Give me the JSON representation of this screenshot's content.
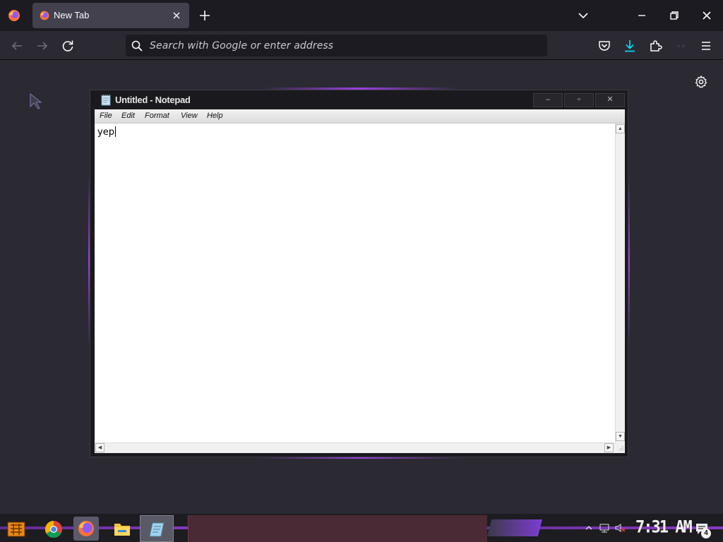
{
  "browser": {
    "tab": {
      "title": "New Tab"
    },
    "urlbar": {
      "placeholder": "Search with Google or enter address"
    }
  },
  "notepad": {
    "title": "Untitled - Notepad",
    "controls": {
      "minimize": "–",
      "maximize": "▫",
      "close": "✕"
    },
    "menu": [
      "File",
      "Edit",
      "Format",
      "View",
      "Help"
    ],
    "content": "yep"
  },
  "taskbar": {
    "apps": [
      "start-icon",
      "chrome-icon",
      "firefox-icon",
      "file-explorer-icon",
      "notepad-icon"
    ],
    "clock": "7:31 AM",
    "notification_count": "4"
  },
  "colors": {
    "accent": "#9b41e0",
    "browser_bg": "#2b2a33",
    "tabstrip_bg": "#1c1b22"
  }
}
